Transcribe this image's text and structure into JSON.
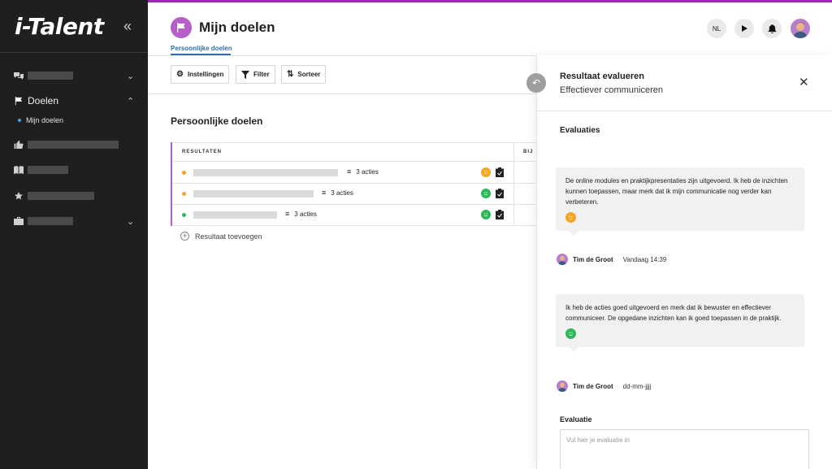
{
  "app": {
    "logo": "i-Talent"
  },
  "sidebar": {
    "items": [
      {
        "label": "",
        "icon": "chat-icon"
      },
      {
        "label": "Doelen",
        "icon": "flag-icon"
      },
      {
        "label": "",
        "icon": "thumbs-up-icon"
      },
      {
        "label": "",
        "icon": "book-icon"
      },
      {
        "label": "",
        "icon": "star-icon"
      },
      {
        "label": "",
        "icon": "briefcase-icon"
      }
    ],
    "sub_item": "Mijn doelen"
  },
  "header": {
    "title": "Mijn doelen",
    "tab": "Persoonlijke doelen",
    "language": "NL"
  },
  "toolbar": {
    "settings": "Instellingen",
    "filter": "Filter",
    "sort": "Sorteer"
  },
  "section": {
    "title": "Persoonlijke doelen",
    "columns": [
      "RESULTATEN",
      "BIJ"
    ],
    "rows": [
      {
        "actions": "3 acties",
        "status_color": "#f5a623",
        "smile_color": "#f5a623"
      },
      {
        "actions": "3 acties",
        "status_color": "#f5a623",
        "smile_color": "#2eb85c"
      },
      {
        "actions": "3 acties",
        "status_color": "#2eb85c",
        "smile_color": "#2eb85c"
      }
    ],
    "add_label": "Resultaat toevoegen"
  },
  "panel": {
    "title": "Resultaat evalueren",
    "subtitle": "Effectiever communiceren",
    "section_title": "Evaluaties",
    "evaluations": [
      {
        "text": "De online modules en praktijkpresentaties zijn uitgevoerd. Ik heb de inzichten kunnen toepassen, maar merk dat ik mijn communicatie nog verder kan verbeteren.",
        "smile_color": "#f5a623",
        "author": "Tim de Groot",
        "time": "Vandaag 14:39"
      },
      {
        "text": "Ik heb de acties goed uitgevoerd en merk dat ik bewuster en effectiever communiceer. De opgedane inzichten kan ik goed toepassen in de praktijk.",
        "smile_color": "#2eb85c",
        "author": "Tim de Groot",
        "time": "dd-mm-jjjj"
      }
    ],
    "input_label": "Evaluatie",
    "input_placeholder": "Vul hier je evaluatie in"
  },
  "colors": {
    "accent": "#9c27b0",
    "link": "#2e6fb3",
    "orange": "#f5a623",
    "green": "#2eb85c"
  }
}
